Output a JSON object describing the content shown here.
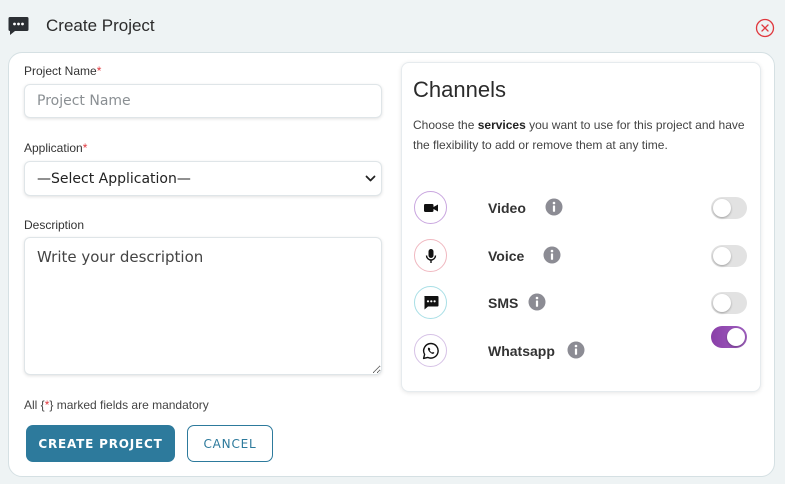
{
  "header": {
    "title": "Create Project",
    "icon": "chat-dots-icon",
    "close_icon": "close-circle-icon"
  },
  "form": {
    "project_name_label": "Project Name",
    "required_mark": "*",
    "project_name_placeholder": "Project Name",
    "project_name_value": "",
    "application_label": "Application",
    "application_selected": "—Select Application—",
    "description_label": "Description",
    "description_placeholder": "Write your description",
    "description_value": "",
    "mandatory_note_prefix": "All {",
    "mandatory_note_star": "*",
    "mandatory_note_suffix": "} marked fields are mandatory",
    "create_button": "CREATE PROJECT",
    "cancel_button": "CANCEL"
  },
  "channels": {
    "title": "Channels",
    "desc_prefix": "Choose the ",
    "desc_bold": "services",
    "desc_suffix": " you want to use for this project and have the flexibility to add or remove them at any time.",
    "items": [
      {
        "name": "Video",
        "icon": "video-camera-icon",
        "enabled": false,
        "ring_color": "#c9a6df"
      },
      {
        "name": "Voice",
        "icon": "microphone-icon",
        "enabled": false,
        "ring_color": "#f0b8c0"
      },
      {
        "name": "SMS",
        "icon": "sms-message-icon",
        "enabled": false,
        "ring_color": "#a9dfe6"
      },
      {
        "name": "Whatsapp",
        "icon": "whatsapp-icon",
        "enabled": true,
        "ring_color": "#d6c2e6"
      }
    ]
  },
  "colors": {
    "primary": "#2d7a9c",
    "required": "#e0383e",
    "toggle_on": "#8a3fa8",
    "close": "#e0383e"
  }
}
